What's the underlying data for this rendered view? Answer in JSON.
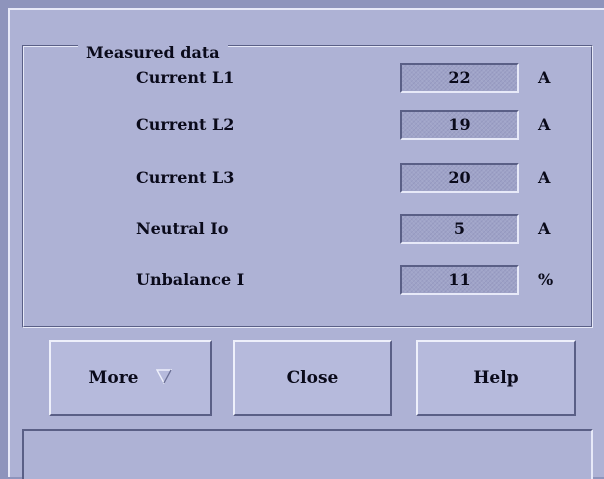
{
  "group": {
    "title": "Measured data"
  },
  "measurements": [
    {
      "label": "Current L1",
      "value": "22",
      "unit": "A"
    },
    {
      "label": "Current L2",
      "value": "19",
      "unit": "A"
    },
    {
      "label": "Current L3",
      "value": "20",
      "unit": "A"
    },
    {
      "label": "Neutral Io",
      "value": "5",
      "unit": "A"
    },
    {
      "label": "Unbalance I",
      "value": "11",
      "unit": "%"
    }
  ],
  "buttons": {
    "more": "More",
    "more_icon": "triangle-down-icon",
    "close": "Close",
    "help": "Help"
  },
  "status": {
    "text": ""
  },
  "colors": {
    "window_bg": "#aeb2d5",
    "field_bg": "#9fa3c8",
    "text": "#0a0a1a"
  }
}
